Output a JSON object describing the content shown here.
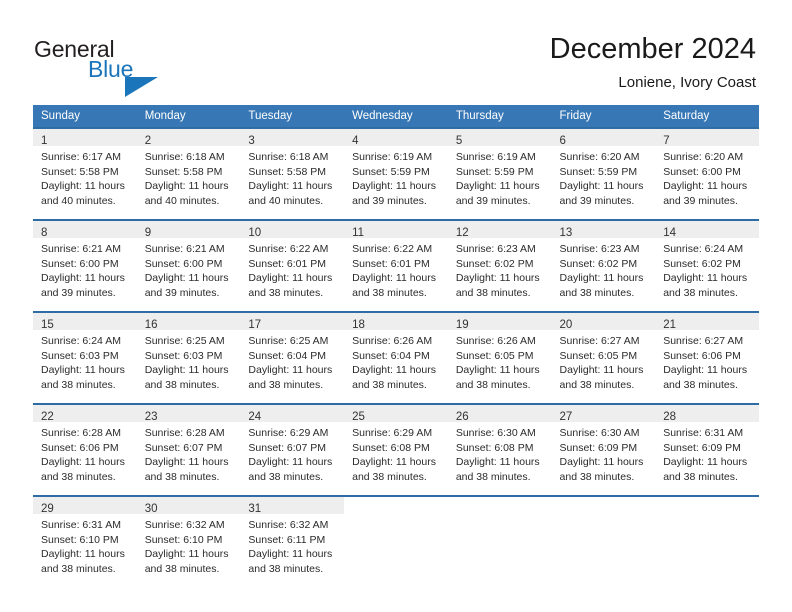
{
  "brand": {
    "name_part1": "General",
    "name_part2": "Blue"
  },
  "header": {
    "title": "December 2024",
    "subtitle": "Loniene, Ivory Coast"
  },
  "weekday_headers": [
    "Sunday",
    "Monday",
    "Tuesday",
    "Wednesday",
    "Thursday",
    "Friday",
    "Saturday"
  ],
  "colors": {
    "header_blue": "#3877b5",
    "row_border_blue": "#2e6da4",
    "daynum_band": "#eeeeee",
    "brand_blue": "#1b75bb"
  },
  "weeks": [
    [
      {
        "day": "1",
        "sunrise": "Sunrise: 6:17 AM",
        "sunset": "Sunset: 5:58 PM",
        "daylight1": "Daylight: 11 hours",
        "daylight2": "and 40 minutes."
      },
      {
        "day": "2",
        "sunrise": "Sunrise: 6:18 AM",
        "sunset": "Sunset: 5:58 PM",
        "daylight1": "Daylight: 11 hours",
        "daylight2": "and 40 minutes."
      },
      {
        "day": "3",
        "sunrise": "Sunrise: 6:18 AM",
        "sunset": "Sunset: 5:58 PM",
        "daylight1": "Daylight: 11 hours",
        "daylight2": "and 40 minutes."
      },
      {
        "day": "4",
        "sunrise": "Sunrise: 6:19 AM",
        "sunset": "Sunset: 5:59 PM",
        "daylight1": "Daylight: 11 hours",
        "daylight2": "and 39 minutes."
      },
      {
        "day": "5",
        "sunrise": "Sunrise: 6:19 AM",
        "sunset": "Sunset: 5:59 PM",
        "daylight1": "Daylight: 11 hours",
        "daylight2": "and 39 minutes."
      },
      {
        "day": "6",
        "sunrise": "Sunrise: 6:20 AM",
        "sunset": "Sunset: 5:59 PM",
        "daylight1": "Daylight: 11 hours",
        "daylight2": "and 39 minutes."
      },
      {
        "day": "7",
        "sunrise": "Sunrise: 6:20 AM",
        "sunset": "Sunset: 6:00 PM",
        "daylight1": "Daylight: 11 hours",
        "daylight2": "and 39 minutes."
      }
    ],
    [
      {
        "day": "8",
        "sunrise": "Sunrise: 6:21 AM",
        "sunset": "Sunset: 6:00 PM",
        "daylight1": "Daylight: 11 hours",
        "daylight2": "and 39 minutes."
      },
      {
        "day": "9",
        "sunrise": "Sunrise: 6:21 AM",
        "sunset": "Sunset: 6:00 PM",
        "daylight1": "Daylight: 11 hours",
        "daylight2": "and 39 minutes."
      },
      {
        "day": "10",
        "sunrise": "Sunrise: 6:22 AM",
        "sunset": "Sunset: 6:01 PM",
        "daylight1": "Daylight: 11 hours",
        "daylight2": "and 38 minutes."
      },
      {
        "day": "11",
        "sunrise": "Sunrise: 6:22 AM",
        "sunset": "Sunset: 6:01 PM",
        "daylight1": "Daylight: 11 hours",
        "daylight2": "and 38 minutes."
      },
      {
        "day": "12",
        "sunrise": "Sunrise: 6:23 AM",
        "sunset": "Sunset: 6:02 PM",
        "daylight1": "Daylight: 11 hours",
        "daylight2": "and 38 minutes."
      },
      {
        "day": "13",
        "sunrise": "Sunrise: 6:23 AM",
        "sunset": "Sunset: 6:02 PM",
        "daylight1": "Daylight: 11 hours",
        "daylight2": "and 38 minutes."
      },
      {
        "day": "14",
        "sunrise": "Sunrise: 6:24 AM",
        "sunset": "Sunset: 6:02 PM",
        "daylight1": "Daylight: 11 hours",
        "daylight2": "and 38 minutes."
      }
    ],
    [
      {
        "day": "15",
        "sunrise": "Sunrise: 6:24 AM",
        "sunset": "Sunset: 6:03 PM",
        "daylight1": "Daylight: 11 hours",
        "daylight2": "and 38 minutes."
      },
      {
        "day": "16",
        "sunrise": "Sunrise: 6:25 AM",
        "sunset": "Sunset: 6:03 PM",
        "daylight1": "Daylight: 11 hours",
        "daylight2": "and 38 minutes."
      },
      {
        "day": "17",
        "sunrise": "Sunrise: 6:25 AM",
        "sunset": "Sunset: 6:04 PM",
        "daylight1": "Daylight: 11 hours",
        "daylight2": "and 38 minutes."
      },
      {
        "day": "18",
        "sunrise": "Sunrise: 6:26 AM",
        "sunset": "Sunset: 6:04 PM",
        "daylight1": "Daylight: 11 hours",
        "daylight2": "and 38 minutes."
      },
      {
        "day": "19",
        "sunrise": "Sunrise: 6:26 AM",
        "sunset": "Sunset: 6:05 PM",
        "daylight1": "Daylight: 11 hours",
        "daylight2": "and 38 minutes."
      },
      {
        "day": "20",
        "sunrise": "Sunrise: 6:27 AM",
        "sunset": "Sunset: 6:05 PM",
        "daylight1": "Daylight: 11 hours",
        "daylight2": "and 38 minutes."
      },
      {
        "day": "21",
        "sunrise": "Sunrise: 6:27 AM",
        "sunset": "Sunset: 6:06 PM",
        "daylight1": "Daylight: 11 hours",
        "daylight2": "and 38 minutes."
      }
    ],
    [
      {
        "day": "22",
        "sunrise": "Sunrise: 6:28 AM",
        "sunset": "Sunset: 6:06 PM",
        "daylight1": "Daylight: 11 hours",
        "daylight2": "and 38 minutes."
      },
      {
        "day": "23",
        "sunrise": "Sunrise: 6:28 AM",
        "sunset": "Sunset: 6:07 PM",
        "daylight1": "Daylight: 11 hours",
        "daylight2": "and 38 minutes."
      },
      {
        "day": "24",
        "sunrise": "Sunrise: 6:29 AM",
        "sunset": "Sunset: 6:07 PM",
        "daylight1": "Daylight: 11 hours",
        "daylight2": "and 38 minutes."
      },
      {
        "day": "25",
        "sunrise": "Sunrise: 6:29 AM",
        "sunset": "Sunset: 6:08 PM",
        "daylight1": "Daylight: 11 hours",
        "daylight2": "and 38 minutes."
      },
      {
        "day": "26",
        "sunrise": "Sunrise: 6:30 AM",
        "sunset": "Sunset: 6:08 PM",
        "daylight1": "Daylight: 11 hours",
        "daylight2": "and 38 minutes."
      },
      {
        "day": "27",
        "sunrise": "Sunrise: 6:30 AM",
        "sunset": "Sunset: 6:09 PM",
        "daylight1": "Daylight: 11 hours",
        "daylight2": "and 38 minutes."
      },
      {
        "day": "28",
        "sunrise": "Sunrise: 6:31 AM",
        "sunset": "Sunset: 6:09 PM",
        "daylight1": "Daylight: 11 hours",
        "daylight2": "and 38 minutes."
      }
    ],
    [
      {
        "day": "29",
        "sunrise": "Sunrise: 6:31 AM",
        "sunset": "Sunset: 6:10 PM",
        "daylight1": "Daylight: 11 hours",
        "daylight2": "and 38 minutes."
      },
      {
        "day": "30",
        "sunrise": "Sunrise: 6:32 AM",
        "sunset": "Sunset: 6:10 PM",
        "daylight1": "Daylight: 11 hours",
        "daylight2": "and 38 minutes."
      },
      {
        "day": "31",
        "sunrise": "Sunrise: 6:32 AM",
        "sunset": "Sunset: 6:11 PM",
        "daylight1": "Daylight: 11 hours",
        "daylight2": "and 38 minutes."
      },
      {
        "day": "",
        "sunrise": "",
        "sunset": "",
        "daylight1": "",
        "daylight2": ""
      },
      {
        "day": "",
        "sunrise": "",
        "sunset": "",
        "daylight1": "",
        "daylight2": ""
      },
      {
        "day": "",
        "sunrise": "",
        "sunset": "",
        "daylight1": "",
        "daylight2": ""
      },
      {
        "day": "",
        "sunrise": "",
        "sunset": "",
        "daylight1": "",
        "daylight2": ""
      }
    ]
  ]
}
